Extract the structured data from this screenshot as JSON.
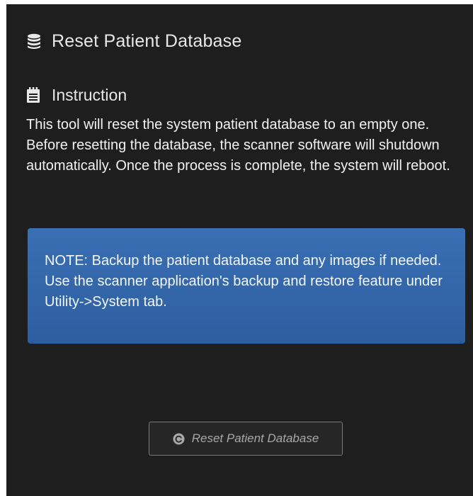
{
  "header": {
    "icon": "database-icon",
    "title": "Reset Patient Database"
  },
  "instruction": {
    "icon": "notepad-icon",
    "title": "Instruction",
    "text": "This tool will reset the system patient database to an empty one. Before resetting the database, the scanner software will shutdown automatically. Once the process is complete, the system will reboot."
  },
  "note": {
    "text": "NOTE: Backup the patient database and any images if needed. Use the scanner application's backup and restore feature under Utility->System tab.",
    "color": "#3567ab"
  },
  "action": {
    "icon": "reset-icon",
    "label": "Reset Patient Database",
    "state": "disabled"
  },
  "colors": {
    "panel_background": "#1e1e1e",
    "text": "#f2f2f2"
  }
}
